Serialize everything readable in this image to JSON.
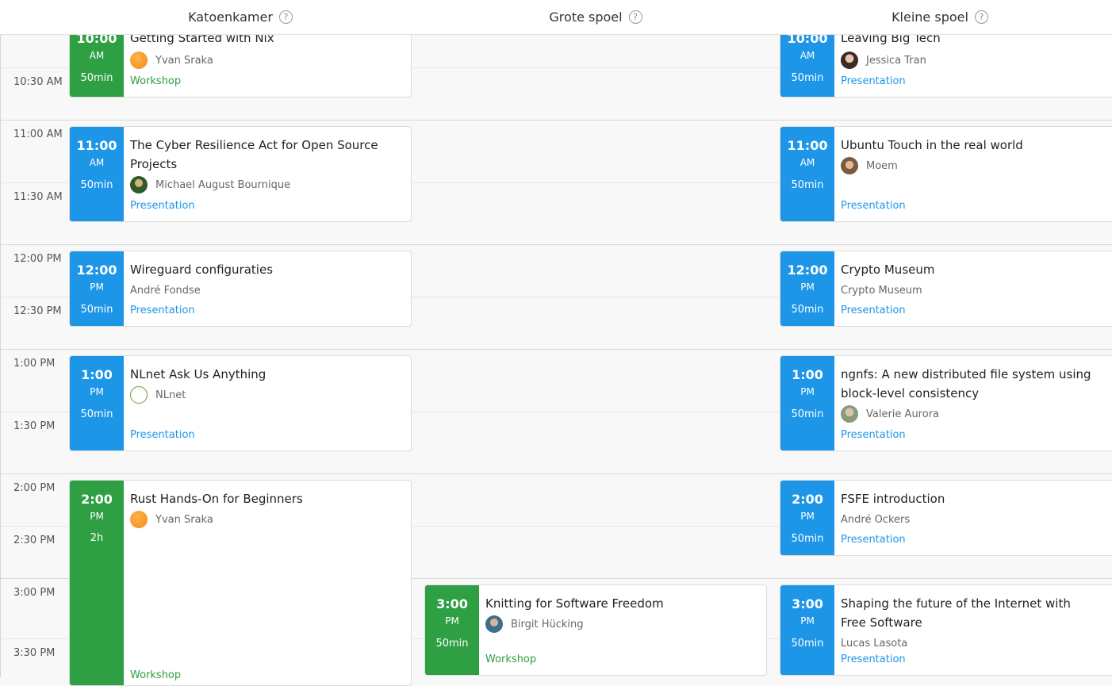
{
  "rooms": [
    {
      "name": "Katoenkamer",
      "help": "?"
    },
    {
      "name": "Grote spoel",
      "help": "?"
    },
    {
      "name": "Kleine spoel",
      "help": "?"
    }
  ],
  "time_labels": [
    "10:30 AM",
    "11:00 AM",
    "11:30 AM",
    "12:00 PM",
    "12:30 PM",
    "1:00 PM",
    "1:30 PM",
    "2:00 PM",
    "2:30 PM",
    "3:00 PM",
    "3:30 PM"
  ],
  "talks": {
    "k1": {
      "time": "10:00",
      "ampm": "AM",
      "duration": "50min",
      "title": "Getting Started with Nix",
      "speaker": "Yvan Sraka",
      "track": "Workshop",
      "color": "#2ea043"
    },
    "k2": {
      "time": "11:00",
      "ampm": "AM",
      "duration": "50min",
      "title": "The Cyber Resilience Act for Open Source Projects",
      "speaker": "Michael August Bournique",
      "track": "Presentation",
      "color": "#1e96e8"
    },
    "k3": {
      "time": "12:00",
      "ampm": "PM",
      "duration": "50min",
      "title": "Wireguard configuraties",
      "speaker": "André Fondse",
      "track": "Presentation",
      "color": "#1e96e8"
    },
    "k4": {
      "time": "1:00",
      "ampm": "PM",
      "duration": "50min",
      "title": "NLnet Ask Us Anything",
      "speaker": "NLnet",
      "track": "Presentation",
      "color": "#1e96e8"
    },
    "k5": {
      "time": "2:00",
      "ampm": "PM",
      "duration": "2h",
      "title": "Rust Hands-On for Beginners",
      "speaker": "Yvan Sraka",
      "track": "Workshop",
      "color": "#2ea043"
    },
    "g1": {
      "time": "3:00",
      "ampm": "PM",
      "duration": "50min",
      "title": "Knitting for Software Freedom",
      "speaker": "Birgit Hücking",
      "track": "Workshop",
      "color": "#2ea043"
    },
    "s1": {
      "time": "10:00",
      "ampm": "AM",
      "duration": "50min",
      "title": "Leaving Big Tech",
      "speaker": "Jessica Tran",
      "track": "Presentation",
      "color": "#1e96e8"
    },
    "s2": {
      "time": "11:00",
      "ampm": "AM",
      "duration": "50min",
      "title": "Ubuntu Touch in the real world",
      "speaker": "Moem",
      "track": "Presentation",
      "color": "#1e96e8"
    },
    "s3": {
      "time": "12:00",
      "ampm": "PM",
      "duration": "50min",
      "title": "Crypto Museum",
      "speaker": "Crypto Museum",
      "track": "Presentation",
      "color": "#1e96e8"
    },
    "s4": {
      "time": "1:00",
      "ampm": "PM",
      "duration": "50min",
      "title": "ngnfs: A new distributed file system using block-level consistency",
      "speaker": "Valerie Aurora",
      "track": "Presentation",
      "color": "#1e96e8"
    },
    "s5": {
      "time": "2:00",
      "ampm": "PM",
      "duration": "50min",
      "title": "FSFE introduction",
      "speaker": "André Ockers",
      "track": "Presentation",
      "color": "#1e96e8"
    },
    "s6": {
      "time": "3:00",
      "ampm": "PM",
      "duration": "50min",
      "title": "Shaping the future of the Internet with Free Software",
      "speaker": "Lucas Lasota",
      "track": "Presentation",
      "color": "#1e96e8"
    }
  }
}
